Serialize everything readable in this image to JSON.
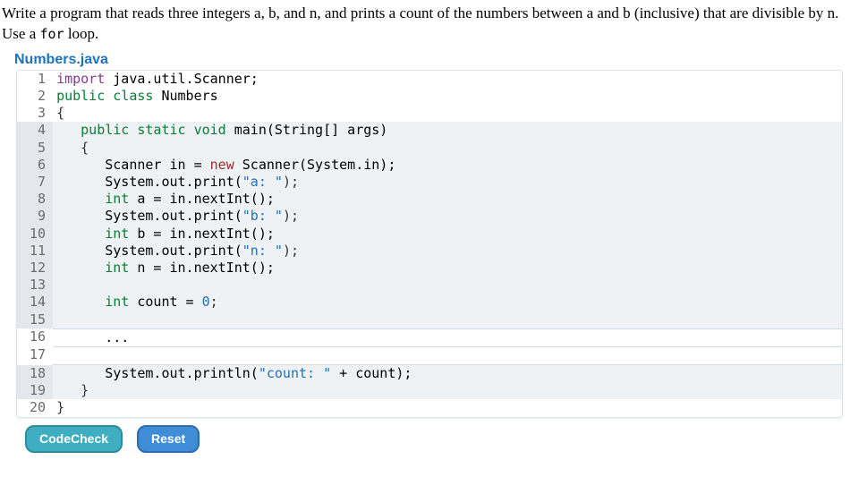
{
  "problem": {
    "text_pre": "Write a program that reads three integers a, b, and n, and prints a count of the numbers between a and b (inclusive) that are divisible by n. Use a ",
    "code_token": "for",
    "text_post": " loop."
  },
  "filename": "Numbers.java",
  "code": {
    "lines": [
      {
        "n": 1,
        "shade": false,
        "tokens": [
          {
            "t": "import ",
            "c": "kw-import"
          },
          {
            "t": "java.util.Scanner;",
            "c": "plain"
          }
        ]
      },
      {
        "n": 2,
        "shade": false,
        "tokens": [
          {
            "t": "public class ",
            "c": "kw-modtype"
          },
          {
            "t": "Numbers",
            "c": "ident-class"
          }
        ]
      },
      {
        "n": 3,
        "shade": false,
        "tokens": [
          {
            "t": "{",
            "c": "punct"
          }
        ]
      },
      {
        "n": 4,
        "shade": true,
        "indent": "   ",
        "tokens": [
          {
            "t": "public static void ",
            "c": "kw-modtype"
          },
          {
            "t": "main(String[] args)",
            "c": "plain"
          }
        ]
      },
      {
        "n": 5,
        "shade": true,
        "indent": "   ",
        "tokens": [
          {
            "t": "{",
            "c": "punct"
          }
        ]
      },
      {
        "n": 6,
        "shade": true,
        "indent": "      ",
        "tokens": [
          {
            "t": "Scanner in = ",
            "c": "plain"
          },
          {
            "t": "new ",
            "c": "kw-new"
          },
          {
            "t": "Scanner(System.in);",
            "c": "plain"
          }
        ]
      },
      {
        "n": 7,
        "shade": true,
        "indent": "      ",
        "tokens": [
          {
            "t": "System.out.print(",
            "c": "plain"
          },
          {
            "t": "\"a: \"",
            "c": "str"
          },
          {
            "t": ");",
            "c": "punct"
          }
        ]
      },
      {
        "n": 8,
        "shade": true,
        "indent": "      ",
        "tokens": [
          {
            "t": "int ",
            "c": "kw-type"
          },
          {
            "t": "a = in.nextInt();",
            "c": "plain"
          }
        ]
      },
      {
        "n": 9,
        "shade": true,
        "indent": "      ",
        "tokens": [
          {
            "t": "System.out.print(",
            "c": "plain"
          },
          {
            "t": "\"b: \"",
            "c": "str"
          },
          {
            "t": ");",
            "c": "punct"
          }
        ]
      },
      {
        "n": 10,
        "shade": true,
        "indent": "      ",
        "tokens": [
          {
            "t": "int ",
            "c": "kw-type"
          },
          {
            "t": "b = in.nextInt();",
            "c": "plain"
          }
        ]
      },
      {
        "n": 11,
        "shade": true,
        "indent": "      ",
        "tokens": [
          {
            "t": "System.out.print(",
            "c": "plain"
          },
          {
            "t": "\"n: \"",
            "c": "str"
          },
          {
            "t": ");",
            "c": "punct"
          }
        ]
      },
      {
        "n": 12,
        "shade": true,
        "indent": "      ",
        "tokens": [
          {
            "t": "int ",
            "c": "kw-type"
          },
          {
            "t": "n = in.nextInt();",
            "c": "plain"
          }
        ]
      },
      {
        "n": 13,
        "shade": true,
        "indent": "",
        "tokens": []
      },
      {
        "n": 14,
        "shade": true,
        "indent": "      ",
        "tokens": [
          {
            "t": "int ",
            "c": "kw-type"
          },
          {
            "t": "count = ",
            "c": "plain"
          },
          {
            "t": "0",
            "c": "num"
          },
          {
            "t": ";",
            "c": "punct"
          }
        ]
      },
      {
        "n": 15,
        "shade": true,
        "indent": "",
        "tokens": []
      },
      {
        "n": 16,
        "shade": false,
        "edit": true,
        "indent": "      ",
        "tokens": [
          {
            "t": "...",
            "c": "plain"
          }
        ]
      },
      {
        "n": 17,
        "shade": false,
        "edit": true,
        "indent": "",
        "tokens": []
      },
      {
        "n": 18,
        "shade": true,
        "indent": "      ",
        "tokens": [
          {
            "t": "System.out.println(",
            "c": "plain"
          },
          {
            "t": "\"count: \"",
            "c": "str"
          },
          {
            "t": " + count);",
            "c": "plain"
          }
        ]
      },
      {
        "n": 19,
        "shade": true,
        "indent": "   ",
        "tokens": [
          {
            "t": "}",
            "c": "punct"
          }
        ]
      },
      {
        "n": 20,
        "shade": false,
        "indent": "",
        "tokens": [
          {
            "t": "}",
            "c": "punct"
          }
        ]
      }
    ]
  },
  "buttons": {
    "check": "CodeCheck",
    "reset": "Reset"
  }
}
